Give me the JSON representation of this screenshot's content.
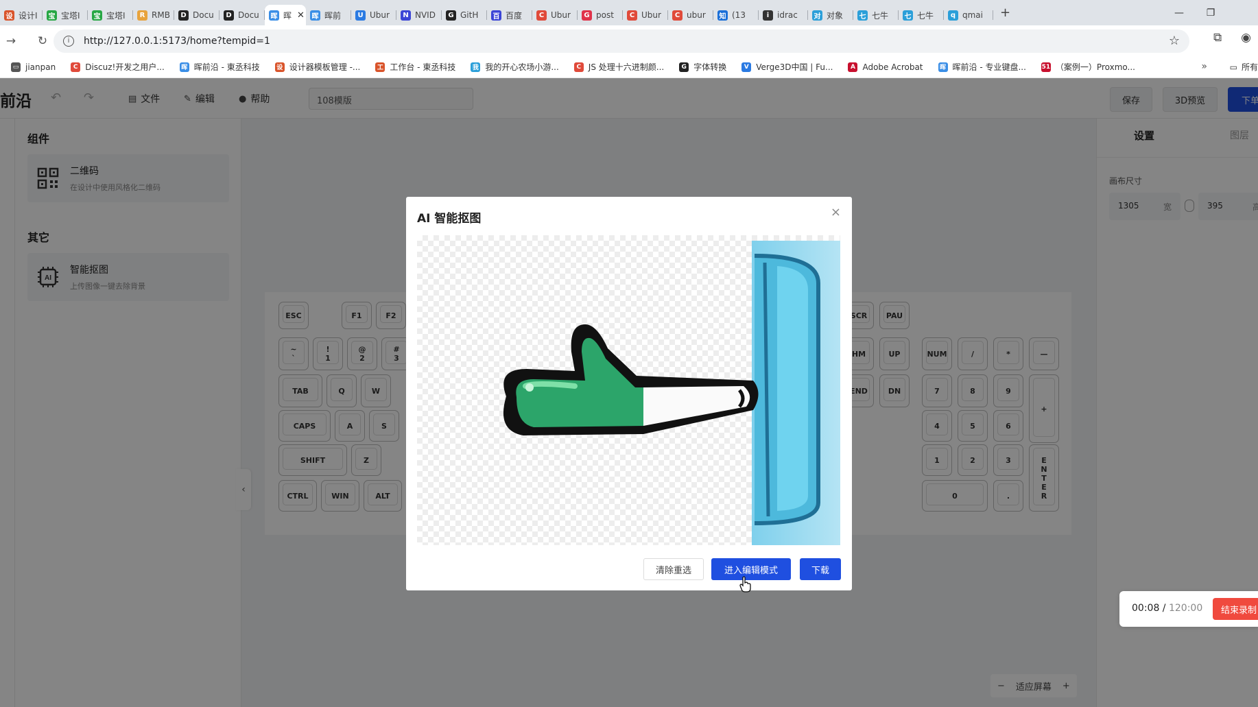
{
  "browser": {
    "tabs": [
      {
        "label": "设计I",
        "color": "#d9542b",
        "glyph": "设"
      },
      {
        "label": "宝塔I",
        "color": "#27a744",
        "glyph": "宝"
      },
      {
        "label": "宝塔I",
        "color": "#27a744",
        "glyph": "宝"
      },
      {
        "label": "RMB",
        "color": "#e8a33d",
        "glyph": "R"
      },
      {
        "label": "Docu",
        "color": "#222222",
        "glyph": "D"
      },
      {
        "label": "Docu",
        "color": "#222222",
        "glyph": "D"
      },
      {
        "label": "晖",
        "color": "#3a8ee6",
        "glyph": "晖",
        "active": true
      },
      {
        "label": "晖前",
        "color": "#3a8ee6",
        "glyph": "晖"
      },
      {
        "label": "Ubur",
        "color": "#2a7ae2",
        "glyph": "U"
      },
      {
        "label": "NVID",
        "color": "#3b45d6",
        "glyph": "N"
      },
      {
        "label": "GitH",
        "color": "#222222",
        "glyph": "G"
      },
      {
        "label": "百度",
        "color": "#3b45d6",
        "glyph": "百"
      },
      {
        "label": "Ubur",
        "color": "#e04a3a",
        "glyph": "C"
      },
      {
        "label": "post",
        "color": "#e0334a",
        "glyph": "G"
      },
      {
        "label": "Ubur",
        "color": "#e04a3a",
        "glyph": "C"
      },
      {
        "label": "ubur",
        "color": "#e04a3a",
        "glyph": "C"
      },
      {
        "label": "(13 ",
        "color": "#1a6fd8",
        "glyph": "知"
      },
      {
        "label": "idrac",
        "color": "#333333",
        "glyph": "i"
      },
      {
        "label": "对象",
        "color": "#2b9fd9",
        "glyph": "对"
      },
      {
        "label": "七牛",
        "color": "#2b9fd9",
        "glyph": "七"
      },
      {
        "label": "七牛",
        "color": "#2b9fd9",
        "glyph": "七"
      },
      {
        "label": "qmai",
        "color": "#2b9fd9",
        "glyph": "q"
      }
    ],
    "url": "http://127.0.0.1:5173/home?tempid=1",
    "bookmarks": [
      {
        "label": "jianpan",
        "color": "#555555",
        "glyph": "▭"
      },
      {
        "label": "Discuz!开发之用户...",
        "color": "#e04a3a",
        "glyph": "C"
      },
      {
        "label": "晖前沿 - 東丞科技",
        "color": "#3a8ee6",
        "glyph": "晖"
      },
      {
        "label": "设计器模板管理 -...",
        "color": "#d9542b",
        "glyph": "设"
      },
      {
        "label": "工作台 - 東丞科技",
        "color": "#d9542b",
        "glyph": "工"
      },
      {
        "label": "我的开心农场小游...",
        "color": "#2b9fd9",
        "glyph": "我"
      },
      {
        "label": "JS 处理十六进制颜...",
        "color": "#e04a3a",
        "glyph": "C"
      },
      {
        "label": "字体转换",
        "color": "#222222",
        "glyph": "G"
      },
      {
        "label": "Verge3D中国 | Fu...",
        "color": "#2a7ae2",
        "glyph": "V"
      },
      {
        "label": "Adobe Acrobat",
        "color": "#c8102e",
        "glyph": "A"
      },
      {
        "label": "晖前沿 - 专业键盘...",
        "color": "#3a8ee6",
        "glyph": "晖"
      },
      {
        "label": "（案例一）Proxmo...",
        "color": "#c8102e",
        "glyph": "51"
      }
    ],
    "bookmarks_more": "»",
    "bookmarks_all": "所有"
  },
  "app": {
    "logo": "前沿",
    "menu": {
      "file": "文件",
      "edit": "编辑",
      "help": "帮助"
    },
    "template_name": "108模版",
    "buttons": {
      "save": "保存",
      "preview3d": "3D预览",
      "order": "下单"
    },
    "left_panel": {
      "section_components": "组件",
      "qrcode_title": "二维码",
      "qrcode_desc": "在设计中使用风格化二维码",
      "section_other": "其它",
      "matting_title": "智能抠图",
      "matting_desc": "上传图像一键去除背景"
    },
    "right_panel": {
      "tab_settings": "设置",
      "tab_layers": "图层",
      "canvas_size_label": "画布尺寸",
      "width_value": "1305",
      "width_unit": "宽",
      "height_value": "395",
      "height_unit": "高"
    },
    "zoom": {
      "minus": "−",
      "label": "适应屏幕",
      "plus": "+"
    },
    "recording": {
      "elapsed": "00:08",
      "total": "120:00",
      "stop": "结束录制"
    },
    "keys": {
      "esc": "ESC",
      "f1": "F1",
      "f2": "F2",
      "scr": "SCR",
      "pau": "PAU",
      "tilde": "~\n`",
      "k1": "!\n1",
      "k2": "@\n2",
      "k3": "#\n3",
      "hm": "HM",
      "up": "UP",
      "num": "NUM",
      "slash": "/",
      "star": "*",
      "minus": "—",
      "tab": "TAB",
      "q": "Q",
      "w": "W",
      "end": "END",
      "dn": "DN",
      "n7": "7",
      "n8": "8",
      "n9": "9",
      "plus": "+",
      "caps": "CAPS",
      "a": "A",
      "s": "S",
      "n4": "4",
      "n5": "5",
      "n6": "6",
      "shift": "SHIFT",
      "z": "Z",
      "n1": "1",
      "n2": "2",
      "n3": "3",
      "enter": "E\nN\nT\nE\nR",
      "ctrl": "CTRL",
      "win": "WIN",
      "alt": "ALT",
      "n0": "0",
      "dot": "."
    }
  },
  "dialog": {
    "title": "AI 智能抠图",
    "close": "×",
    "btn_clear": "清除重选",
    "btn_edit": "进入编辑模式",
    "btn_download": "下载"
  }
}
